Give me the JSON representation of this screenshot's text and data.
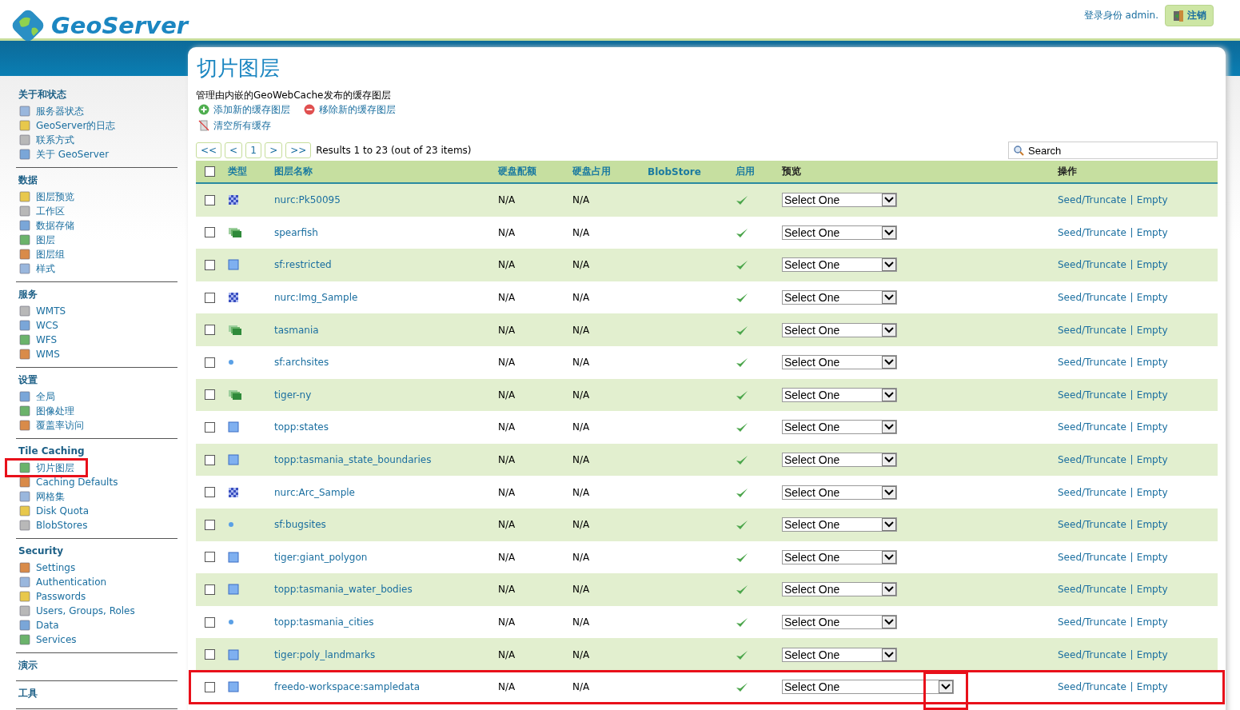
{
  "header": {
    "logo_text": "GeoServer",
    "login_text": "登录身份 admin.",
    "logout_button": "注销"
  },
  "sidebar": [
    {
      "title": "关于和状态",
      "items": [
        {
          "label": "服务器状态",
          "highlighted": false
        },
        {
          "label": "GeoServer的日志",
          "highlighted": false
        },
        {
          "label": "联系方式",
          "highlighted": false
        },
        {
          "label": "关于 GeoServer",
          "highlighted": false
        }
      ]
    },
    {
      "title": "数据",
      "items": [
        {
          "label": "图层预览",
          "highlighted": false
        },
        {
          "label": "工作区",
          "highlighted": false
        },
        {
          "label": "数据存储",
          "highlighted": false
        },
        {
          "label": "图层",
          "highlighted": false
        },
        {
          "label": "图层组",
          "highlighted": false
        },
        {
          "label": "样式",
          "highlighted": false
        }
      ]
    },
    {
      "title": "服务",
      "items": [
        {
          "label": "WMTS",
          "highlighted": false
        },
        {
          "label": "WCS",
          "highlighted": false
        },
        {
          "label": "WFS",
          "highlighted": false
        },
        {
          "label": "WMS",
          "highlighted": false
        }
      ]
    },
    {
      "title": "设置",
      "items": [
        {
          "label": "全局",
          "highlighted": false
        },
        {
          "label": "图像处理",
          "highlighted": false
        },
        {
          "label": "覆盖率访问",
          "highlighted": false
        }
      ]
    },
    {
      "title": "Tile Caching",
      "items": [
        {
          "label": "切片图层",
          "highlighted": true
        },
        {
          "label": "Caching Defaults",
          "highlighted": false
        },
        {
          "label": "网格集",
          "highlighted": false
        },
        {
          "label": "Disk Quota",
          "highlighted": false
        },
        {
          "label": "BlobStores",
          "highlighted": false
        }
      ]
    },
    {
      "title": "Security",
      "items": [
        {
          "label": "Settings",
          "highlighted": false
        },
        {
          "label": "Authentication",
          "highlighted": false
        },
        {
          "label": "Passwords",
          "highlighted": false
        },
        {
          "label": "Users, Groups, Roles",
          "highlighted": false
        },
        {
          "label": "Data",
          "highlighted": false
        },
        {
          "label": "Services",
          "highlighted": false
        }
      ]
    },
    {
      "title": "演示"
    },
    {
      "title": "工具"
    }
  ],
  "page": {
    "title": "切片图层",
    "description": "管理由内嵌的GeoWebCache发布的缓存图层",
    "actions": [
      {
        "kind": "add",
        "label": "添加新的缓存图层"
      },
      {
        "kind": "remove",
        "label": "移除新的缓存图层"
      },
      {
        "kind": "clear",
        "label": "清空所有缓存"
      }
    ]
  },
  "pager": {
    "buttons": [
      "<<",
      "<",
      "1",
      ">",
      ">>"
    ],
    "results": "Results 1 to 23 (out of 23 items)",
    "search_placeholder": "Search"
  },
  "table": {
    "select_all_checked": false,
    "columns": [
      "类型",
      "图层名称",
      "硬盘配额",
      "硬盘占用",
      "BlobStore",
      "启用",
      "预览",
      "操作"
    ],
    "rows": [
      {
        "kind": "raster",
        "name": "nurc:Pk50095",
        "quota": "N/A",
        "usage": "N/A",
        "enabled": true,
        "preview": "Select One",
        "seed": "Seed/Truncate",
        "empty": "Empty",
        "checked": false,
        "highlighted": false
      },
      {
        "kind": "group",
        "name": "spearfish",
        "quota": "N/A",
        "usage": "N/A",
        "enabled": true,
        "preview": "Select One",
        "seed": "Seed/Truncate",
        "empty": "Empty",
        "checked": false,
        "highlighted": false
      },
      {
        "kind": "polygon",
        "name": "sf:restricted",
        "quota": "N/A",
        "usage": "N/A",
        "enabled": true,
        "preview": "Select One",
        "seed": "Seed/Truncate",
        "empty": "Empty",
        "checked": false,
        "highlighted": false
      },
      {
        "kind": "raster",
        "name": "nurc:Img_Sample",
        "quota": "N/A",
        "usage": "N/A",
        "enabled": true,
        "preview": "Select One",
        "seed": "Seed/Truncate",
        "empty": "Empty",
        "checked": false,
        "highlighted": false
      },
      {
        "kind": "group",
        "name": "tasmania",
        "quota": "N/A",
        "usage": "N/A",
        "enabled": true,
        "preview": "Select One",
        "seed": "Seed/Truncate",
        "empty": "Empty",
        "checked": false,
        "highlighted": false
      },
      {
        "kind": "point",
        "name": "sf:archsites",
        "quota": "N/A",
        "usage": "N/A",
        "enabled": true,
        "preview": "Select One",
        "seed": "Seed/Truncate",
        "empty": "Empty",
        "checked": false,
        "highlighted": false
      },
      {
        "kind": "group",
        "name": "tiger-ny",
        "quota": "N/A",
        "usage": "N/A",
        "enabled": true,
        "preview": "Select One",
        "seed": "Seed/Truncate",
        "empty": "Empty",
        "checked": false,
        "highlighted": false
      },
      {
        "kind": "polygon",
        "name": "topp:states",
        "quota": "N/A",
        "usage": "N/A",
        "enabled": true,
        "preview": "Select One",
        "seed": "Seed/Truncate",
        "empty": "Empty",
        "checked": false,
        "highlighted": false
      },
      {
        "kind": "polygon",
        "name": "topp:tasmania_state_boundaries",
        "quota": "N/A",
        "usage": "N/A",
        "enabled": true,
        "preview": "Select One",
        "seed": "Seed/Truncate",
        "empty": "Empty",
        "checked": false,
        "highlighted": false
      },
      {
        "kind": "raster",
        "name": "nurc:Arc_Sample",
        "quota": "N/A",
        "usage": "N/A",
        "enabled": true,
        "preview": "Select One",
        "seed": "Seed/Truncate",
        "empty": "Empty",
        "checked": false,
        "highlighted": false
      },
      {
        "kind": "point",
        "name": "sf:bugsites",
        "quota": "N/A",
        "usage": "N/A",
        "enabled": true,
        "preview": "Select One",
        "seed": "Seed/Truncate",
        "empty": "Empty",
        "checked": false,
        "highlighted": false
      },
      {
        "kind": "polygon",
        "name": "tiger:giant_polygon",
        "quota": "N/A",
        "usage": "N/A",
        "enabled": true,
        "preview": "Select One",
        "seed": "Seed/Truncate",
        "empty": "Empty",
        "checked": false,
        "highlighted": false
      },
      {
        "kind": "polygon",
        "name": "topp:tasmania_water_bodies",
        "quota": "N/A",
        "usage": "N/A",
        "enabled": true,
        "preview": "Select One",
        "seed": "Seed/Truncate",
        "empty": "Empty",
        "checked": false,
        "highlighted": false
      },
      {
        "kind": "point",
        "name": "topp:tasmania_cities",
        "quota": "N/A",
        "usage": "N/A",
        "enabled": true,
        "preview": "Select One",
        "seed": "Seed/Truncate",
        "empty": "Empty",
        "checked": false,
        "highlighted": false
      },
      {
        "kind": "polygon",
        "name": "tiger:poly_landmarks",
        "quota": "N/A",
        "usage": "N/A",
        "enabled": true,
        "preview": "Select One",
        "seed": "Seed/Truncate",
        "empty": "Empty",
        "checked": false,
        "highlighted": false
      },
      {
        "kind": "polygon",
        "name": "freedo-workspace:sampledata",
        "quota": "N/A",
        "usage": "N/A",
        "enabled": true,
        "preview": "Select One",
        "seed": "Seed/Truncate",
        "empty": "Empty",
        "checked": false,
        "highlighted": true
      }
    ]
  }
}
